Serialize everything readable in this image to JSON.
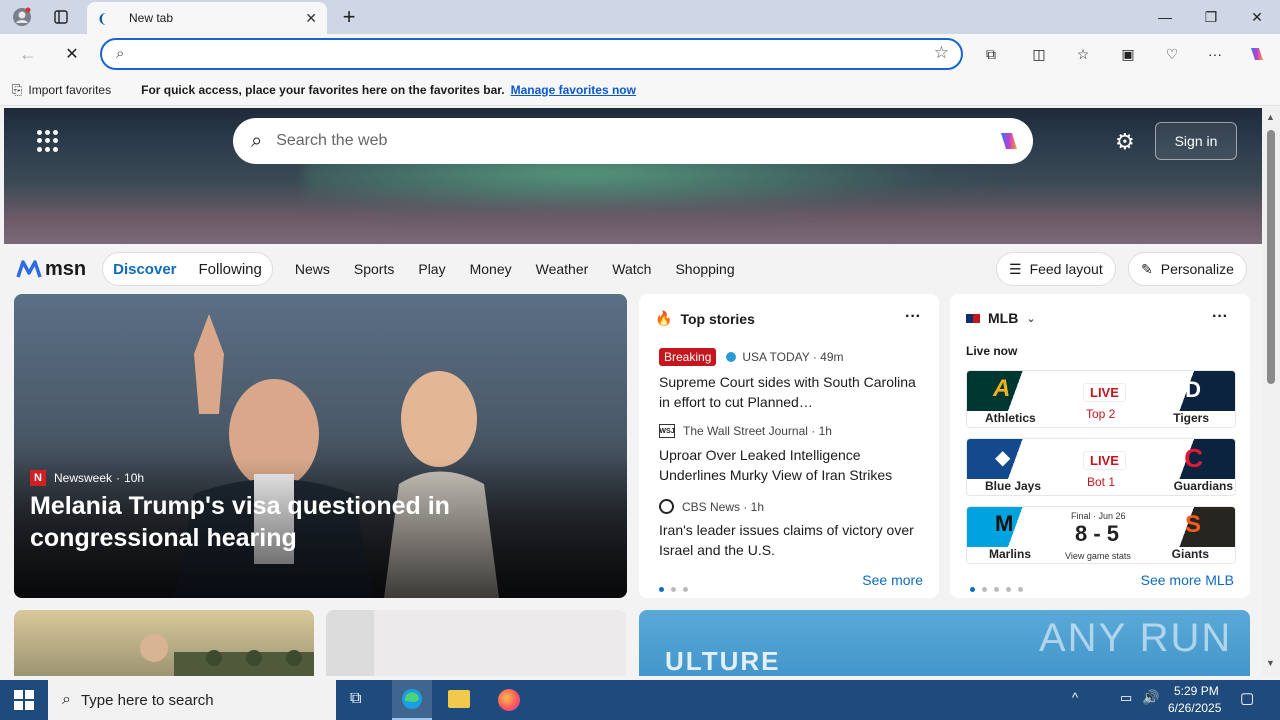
{
  "browser": {
    "tab_title": "New tab",
    "new_tab_symbol": "+",
    "address_value": "",
    "favorites_bar": {
      "import_label": "Import favorites",
      "message": "For quick access, place your favorites here on the favorites bar.",
      "manage_link": "Manage favorites now"
    }
  },
  "msn": {
    "search_placeholder": "Search the web",
    "sign_in": "Sign in",
    "logo": "msn",
    "tabs": [
      "Discover",
      "Following"
    ],
    "nav": [
      "News",
      "Sports",
      "Play",
      "Money",
      "Weather",
      "Watch",
      "Shopping"
    ],
    "feed_layout": "Feed layout",
    "personalize": "Personalize",
    "hero_story": {
      "source": "Newsweek",
      "age": "10h",
      "headline": "Melania Trump's visa questioned in congressional hearing"
    },
    "top_stories": {
      "title": "Top stories",
      "breaking": "Breaking",
      "see_more": "See more",
      "items": [
        {
          "source": "USA TODAY · 49m",
          "headline": "Supreme Court sides with South Carolina in effort to cut Planned…"
        },
        {
          "source": "The Wall Street Journal · 1h",
          "headline": "Uproar Over Leaked Intelligence Underlines Murky View of Iran Strikes"
        },
        {
          "source": "CBS News · 1h",
          "headline": "Iran's leader issues claims of victory over Israel and the U.S."
        }
      ]
    },
    "mlb": {
      "title": "MLB",
      "live_now": "Live now",
      "see_more": "See more MLB",
      "games": [
        {
          "away": "Athletics",
          "home": "Tigers",
          "status": "LIVE",
          "detail": "Top 2",
          "away_color": "#003831",
          "home_color": "#0c2340"
        },
        {
          "away": "Blue Jays",
          "home": "Guardians",
          "status": "LIVE",
          "detail": "Bot 1",
          "away_color": "#134a8e",
          "home_color": "#0c2340"
        },
        {
          "away": "Marlins",
          "home": "Giants",
          "status": "Final · Jun 26",
          "detail": "8 - 5",
          "extra": "View game stats",
          "away_color": "#00a3e0",
          "home_color": "#27251f"
        }
      ]
    }
  },
  "taskbar": {
    "search_placeholder": "Type here to search",
    "time": "5:29 PM",
    "date": "6/26/2025"
  },
  "watermark": "ANY RUN"
}
